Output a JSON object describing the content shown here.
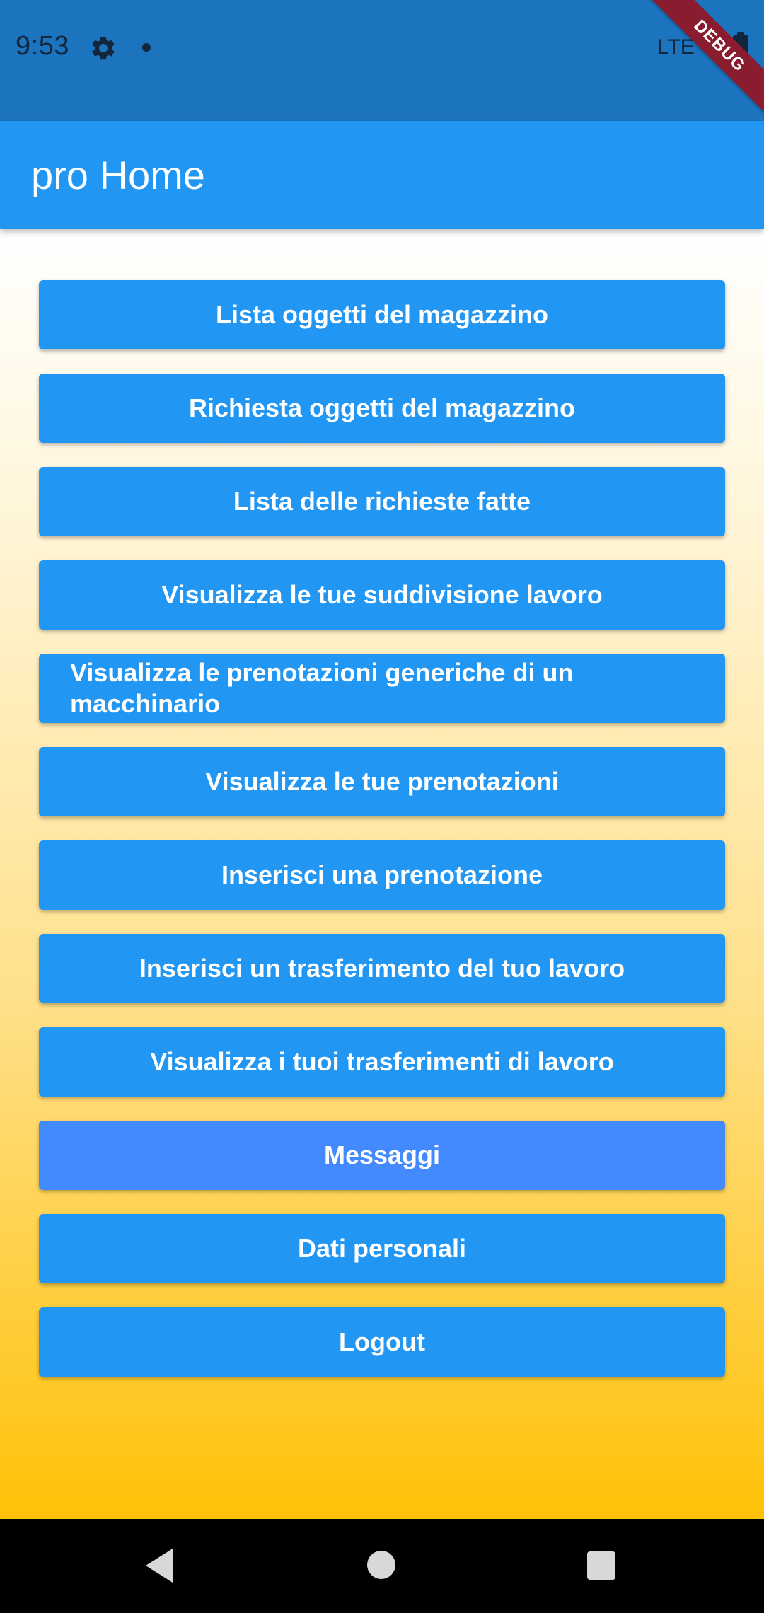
{
  "status_bar": {
    "time": "9:53",
    "network": "LTE",
    "icons": [
      "gear-icon",
      "notification-dot-icon",
      "battery-icon"
    ]
  },
  "debug_banner": "DEBUG",
  "app_bar": {
    "title": "pro Home"
  },
  "menu": {
    "items": [
      {
        "label": "Lista oggetti del magazzino"
      },
      {
        "label": "Richiesta oggetti del magazzino"
      },
      {
        "label": "Lista delle richieste fatte"
      },
      {
        "label": "Visualizza le tue suddivisione lavoro"
      },
      {
        "label": "Visualizza le prenotazioni generiche di un macchinario"
      },
      {
        "label": "Visualizza le tue prenotazioni"
      },
      {
        "label": "Inserisci una prenotazione"
      },
      {
        "label": "Inserisci un trasferimento del tuo lavoro"
      },
      {
        "label": "Visualizza i tuoi trasferimenti di lavoro"
      },
      {
        "label": "Messaggi"
      },
      {
        "label": "Dati personali"
      },
      {
        "label": "Logout"
      }
    ]
  },
  "colors": {
    "status_bar": "#1D74BE",
    "app_bar": "#2196F3",
    "button": "#2196F3",
    "button_highlight": "#448AFF",
    "gradient_bottom": "#FFC107"
  },
  "nav_bar": {
    "icons": [
      "back-icon",
      "home-icon",
      "recents-icon"
    ]
  }
}
